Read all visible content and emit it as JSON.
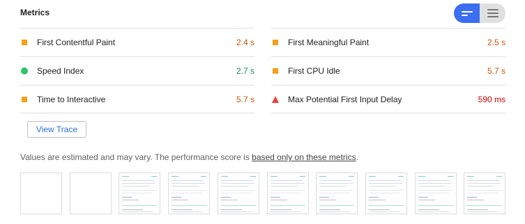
{
  "header": {
    "title": "Metrics"
  },
  "view_toggle": {
    "active": "opportunity",
    "accent": "#3b6ef0"
  },
  "metrics": {
    "left": [
      {
        "label": "First Contentful Paint",
        "value": "2.4 s",
        "rating": "average",
        "indicator": "orange-square"
      },
      {
        "label": "Speed Index",
        "value": "2.7 s",
        "rating": "pass",
        "indicator": "green-circle"
      },
      {
        "label": "Time to Interactive",
        "value": "5.7 s",
        "rating": "average",
        "indicator": "orange-square"
      }
    ],
    "right": [
      {
        "label": "First Meaningful Paint",
        "value": "2.5 s",
        "rating": "average",
        "indicator": "orange-square"
      },
      {
        "label": "First CPU Idle",
        "value": "5.7 s",
        "rating": "average",
        "indicator": "orange-square"
      },
      {
        "label": "Max Potential First Input Delay",
        "value": "590 ms",
        "rating": "fail",
        "indicator": "red-triangle"
      }
    ]
  },
  "actions": {
    "view_trace": "View Trace"
  },
  "note": {
    "prefix": "Values are estimated and may vary. The performance score is ",
    "link": "based only on these metrics",
    "suffix": "."
  },
  "filmstrip": {
    "frames": [
      "blank",
      "blank",
      "rendered",
      "rendered",
      "rendered",
      "rendered",
      "rendered",
      "rendered",
      "rendered",
      "rendered"
    ]
  },
  "colors": {
    "average": "#f4a018",
    "pass": "#2fc265",
    "fail": "#e8403f",
    "link": "#2b71d6"
  }
}
